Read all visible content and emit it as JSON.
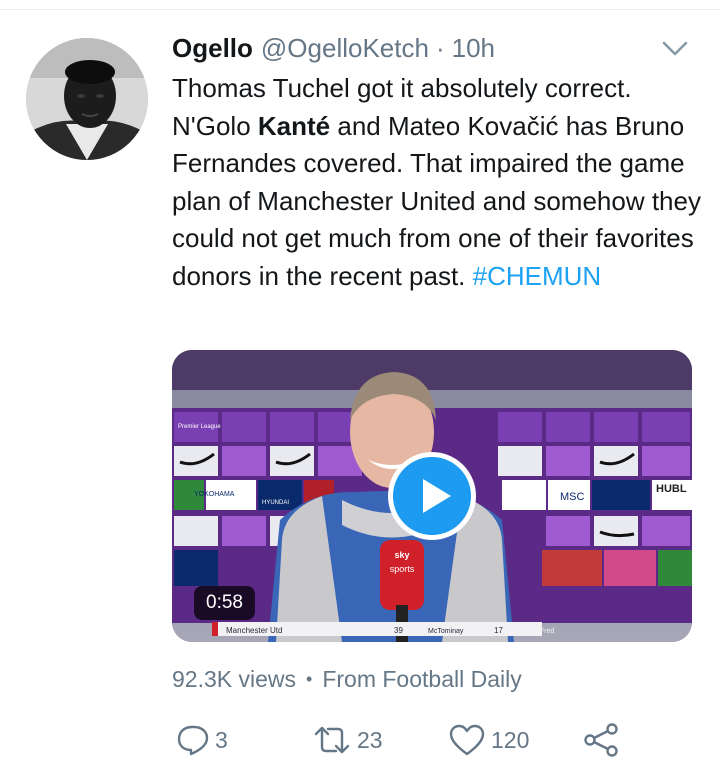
{
  "tweet": {
    "display_name": "Ogello",
    "handle": "@OgelloKetch",
    "separator": "·",
    "time": "10h",
    "text_part1": "Thomas Tuchel got it absolutely correct. N'Golo ",
    "text_bold": "Kanté",
    "text_part2": " and Mateo Kovačić has Bruno Fernandes covered. That impaired the game plan of Manchester United and somehow they could not get much from one of their favorites donors in the recent past. ",
    "hashtag": "#CHEMUN"
  },
  "media": {
    "duration": "0:58",
    "overlay_texts": {
      "sky": "sky",
      "sports": "sports",
      "scoreboard_team": "Manchester Utd",
      "scoreboard_min": "39",
      "scoreboard_player": "McTominay",
      "scoreboard_num": "17",
      "scoreboard_fred": "Fred",
      "sponsor_msc": "MSC",
      "sponsor_hublot": "HUBL",
      "sponsor_hyundai": "HYUNDAI",
      "sponsor_yokohama": "YOKOHAMA",
      "sponsor_pl": "Premier League"
    }
  },
  "meta": {
    "views": "92.3K views",
    "separator": "•",
    "source": "From Football Daily"
  },
  "actions": {
    "reply_count": "3",
    "retweet_count": "23",
    "like_count": "120"
  },
  "colors": {
    "accent": "#1da1f2",
    "play": "#1d9bf0",
    "muted": "#657786",
    "text": "#14171a",
    "board_purple": "#5b2a86",
    "board_teal": "#00a4a6"
  },
  "icons": {
    "reply": "reply-icon",
    "retweet": "retweet-icon",
    "like": "heart-icon",
    "share": "share-icon",
    "more": "chevron-down-icon",
    "play": "play-icon"
  }
}
